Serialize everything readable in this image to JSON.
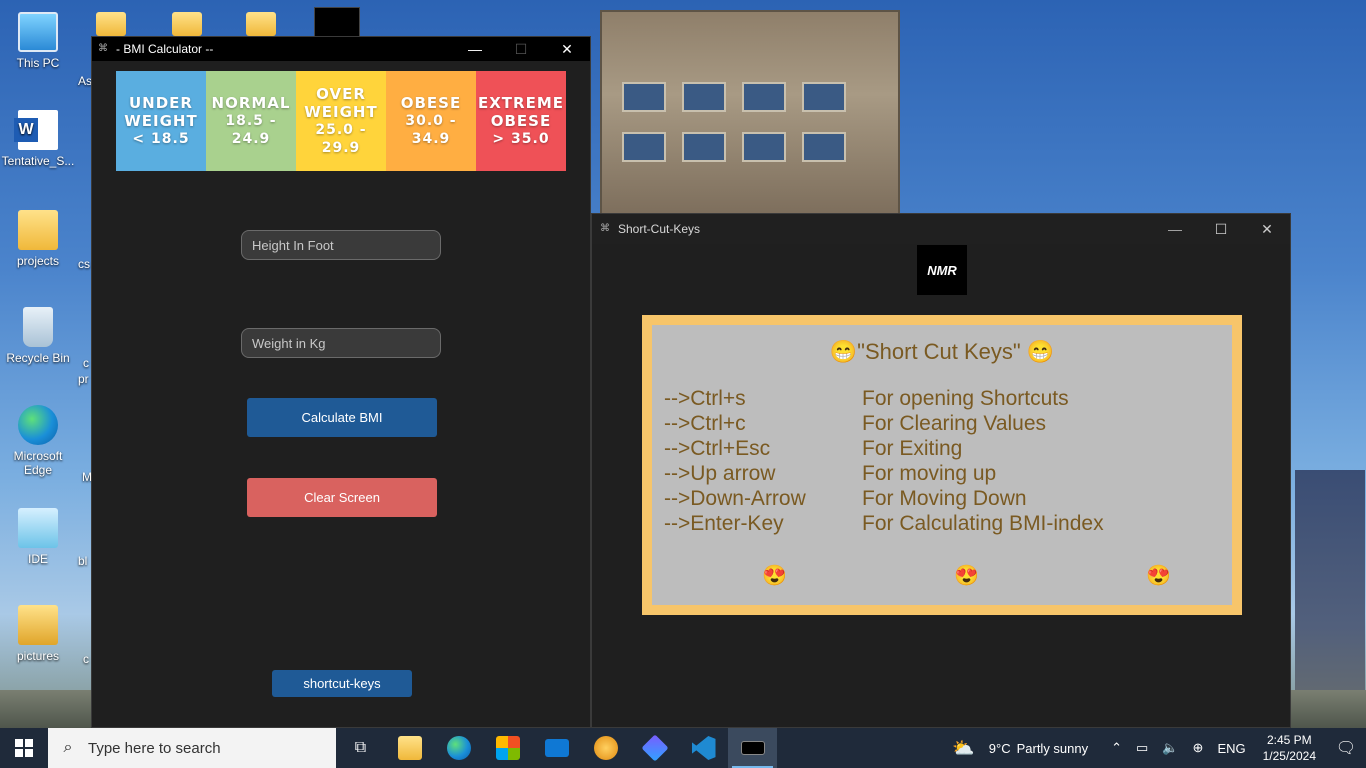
{
  "desktop": {
    "icons": [
      {
        "label": "This PC"
      },
      {
        "label": "Tentative_S..."
      },
      {
        "label": "projects"
      },
      {
        "label": "Recycle Bin"
      },
      {
        "label": "Microsoft Edge"
      },
      {
        "label": "IDE"
      },
      {
        "label": "pictures"
      }
    ],
    "partial_labels": [
      "As",
      "cs",
      "c",
      "pr",
      "M",
      "bl",
      "c"
    ]
  },
  "bmi_window": {
    "title": "- BMI Calculator --",
    "minimize": "—",
    "maximize": "☐",
    "close": "✕",
    "categories": [
      {
        "name_line1": "UNDER",
        "name_line2": "WEIGHT",
        "range": "< 18.5",
        "color": "#5aaee0"
      },
      {
        "name_line1": "NORMAL",
        "name_line2": "",
        "range": "18.5 - 24.9",
        "color": "#a9d18e"
      },
      {
        "name_line1": "OVER",
        "name_line2": "WEIGHT",
        "range": "25.0 - 29.9",
        "color": "#ffd43b"
      },
      {
        "name_line1": "OBESE",
        "name_line2": "",
        "range": "30.0 - 34.9",
        "color": "#ffae42"
      },
      {
        "name_line1": "EXTREME",
        "name_line2": "OBESE",
        "range": "> 35.0",
        "color": "#ef5157"
      }
    ],
    "height_placeholder": "Height In Foot",
    "weight_placeholder": "Weight in Kg",
    "calculate_label": "Calculate BMI",
    "clear_label": "Clear Screen",
    "shortcut_label": "shortcut-keys",
    "calculate_color": "#1f5a96",
    "clear_color": "#d9625f",
    "shortcut_color": "#1f5a96"
  },
  "shortcut_window": {
    "title": "Short-Cut-Keys",
    "minimize": "—",
    "maximize": "☐",
    "close": "✕",
    "logo_text": "NMR",
    "heading": "😁\"Short Cut Keys\" 😁",
    "rows": [
      {
        "key": "-->Ctrl+s",
        "desc": "For opening Shortcuts"
      },
      {
        "key": "-->Ctrl+c",
        "desc": "For Clearing Values"
      },
      {
        "key": "-->Ctrl+Esc",
        "desc": "For Exiting"
      },
      {
        "key": "-->Up arrow",
        "desc": "For moving up"
      },
      {
        "key": "-->Down-Arrow",
        "desc": "For Moving Down"
      },
      {
        "key": "-->Enter-Key",
        "desc": "For Calculating BMI-index"
      }
    ],
    "emojis": [
      "😍",
      "😍",
      "😍"
    ],
    "panel_bg": "#bdbdbd",
    "panel_border": "#f7c56a",
    "text_color": "#7a5a22"
  },
  "taskbar": {
    "search_placeholder": "Type here to search",
    "weather_temp": "9°C",
    "weather_desc": "Partly sunny",
    "language": "ENG",
    "time": "2:45 PM",
    "date": "1/25/2024"
  }
}
